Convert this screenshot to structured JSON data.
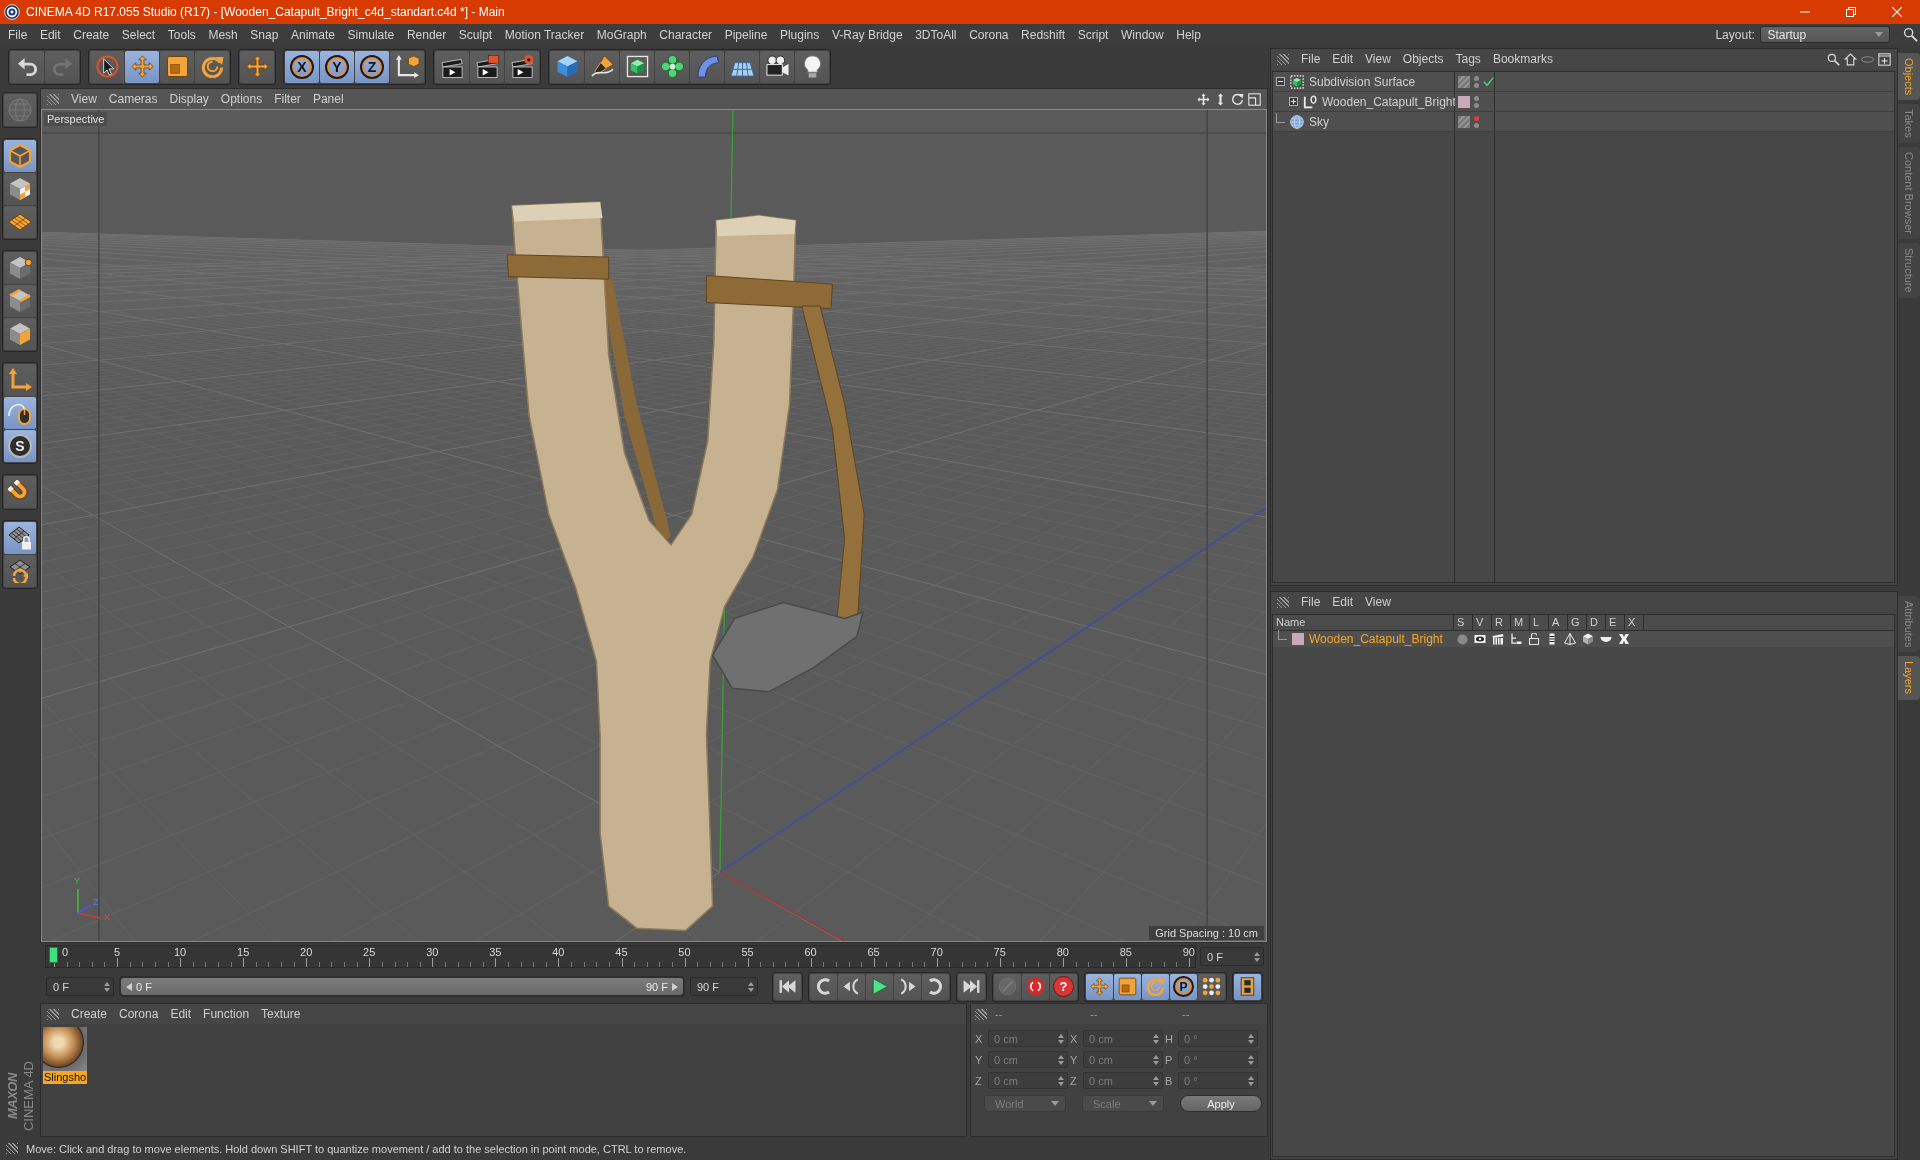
{
  "window": {
    "title": "CINEMA 4D R17.055 Studio (R17) - [Wooden_Catapult_Bright_c4d_standart.c4d *] - Main"
  },
  "menu_bar": {
    "items": [
      "File",
      "Edit",
      "Create",
      "Select",
      "Tools",
      "Mesh",
      "Snap",
      "Animate",
      "Simulate",
      "Render",
      "Sculpt",
      "Motion Tracker",
      "MoGraph",
      "Character",
      "Pipeline",
      "Plugins",
      "V-Ray Bridge",
      "3DToAll",
      "Corona",
      "Redshift",
      "Script",
      "Window",
      "Help"
    ],
    "layout_label": "Layout:",
    "layout_value": "Startup"
  },
  "toolbar": {
    "groups": [
      {
        "buttons": [
          {
            "active": false,
            "disabled": false
          },
          {
            "active": false,
            "disabled": true
          }
        ]
      },
      {
        "buttons": [
          {
            "active": false,
            "disabled": false
          },
          {
            "active": true,
            "disabled": false
          },
          {
            "active": false,
            "disabled": false
          },
          {
            "active": false,
            "disabled": false
          }
        ]
      },
      {
        "buttons": [
          {
            "active": false,
            "disabled": false
          }
        ]
      },
      {
        "buttons": [
          {
            "label": "X",
            "active": true,
            "disabled": false
          },
          {
            "label": "Y",
            "active": true,
            "disabled": false
          },
          {
            "label": "Z",
            "active": true,
            "disabled": false
          },
          {
            "active": false,
            "disabled": false
          }
        ]
      },
      {
        "buttons": [
          {
            "active": false,
            "disabled": false
          },
          {
            "active": false,
            "disabled": false
          },
          {
            "active": false,
            "disabled": false
          }
        ]
      },
      {
        "buttons": [
          {
            "active": false,
            "disabled": false
          },
          {
            "active": false,
            "disabled": false
          },
          {
            "active": false,
            "disabled": false
          },
          {
            "active": false,
            "disabled": false
          },
          {
            "active": false,
            "disabled": false
          },
          {
            "active": false,
            "disabled": false
          },
          {
            "active": false,
            "disabled": false
          },
          {
            "active": false,
            "disabled": false
          }
        ]
      }
    ]
  },
  "left_toolbar": {
    "groups": [
      {
        "buttons": [
          {
            "active": false,
            "disabled": true
          }
        ]
      },
      {
        "buttons": [
          {
            "active": true,
            "disabled": false
          },
          {
            "active": false,
            "disabled": false
          },
          {
            "active": false,
            "disabled": false
          }
        ]
      },
      {
        "buttons": [
          {
            "active": false,
            "disabled": false
          },
          {
            "active": false,
            "disabled": false
          },
          {
            "active": false,
            "disabled": false
          }
        ]
      },
      {
        "buttons": [
          {
            "active": false,
            "disabled": false
          },
          {
            "active": true,
            "disabled": false
          },
          {
            "label": "S",
            "active": true,
            "disabled": false
          }
        ]
      },
      {
        "buttons": [
          {
            "active": false,
            "disabled": false
          }
        ]
      },
      {
        "buttons": [
          {
            "active": true,
            "disabled": false
          },
          {
            "active": false,
            "disabled": false
          }
        ]
      }
    ]
  },
  "brand": {
    "company": "MAXON",
    "product": "CINEMA 4D"
  },
  "viewport": {
    "menu": [
      "View",
      "Cameras",
      "Display",
      "Options",
      "Filter",
      "Panel"
    ],
    "camera": "Perspective",
    "grid_spacing": "Grid Spacing : 10 cm",
    "axis_labels": [
      "Y",
      "Z",
      "X"
    ]
  },
  "timeline": {
    "ticks": [
      "0",
      "5",
      "10",
      "15",
      "20",
      "25",
      "30",
      "35",
      "40",
      "45",
      "50",
      "55",
      "60",
      "65",
      "70",
      "75",
      "80",
      "85",
      "90"
    ],
    "level": 0,
    "frame_field": "0 F"
  },
  "playback": {
    "start_field": "0 F",
    "range": {
      "start_label": "0 F",
      "end_label": "90 F",
      "level": 1
    },
    "end_field": "90 F",
    "groups": [
      {
        "buttons": [
          {
            "active": false,
            "disabled": false
          }
        ]
      },
      {
        "buttons": [
          {
            "active": false,
            "disabled": false
          },
          {
            "active": false,
            "disabled": false
          },
          {
            "active": false,
            "disabled": false
          },
          {
            "active": false,
            "disabled": false
          },
          {
            "active": false,
            "disabled": false
          }
        ]
      },
      {
        "buttons": [
          {
            "active": false,
            "disabled": false
          }
        ]
      },
      {
        "buttons": [
          {
            "active": false,
            "disabled": true
          },
          {
            "active": false,
            "disabled": false
          },
          {
            "label": "?",
            "active": false,
            "disabled": false
          }
        ]
      },
      {
        "buttons": [
          {
            "active": true,
            "disabled": false
          },
          {
            "active": true,
            "disabled": false
          },
          {
            "active": true,
            "disabled": false
          },
          {
            "label": "P",
            "active": true,
            "disabled": false
          },
          {
            "active": false,
            "disabled": false
          }
        ]
      },
      {
        "buttons": [
          {
            "active": true,
            "disabled": false
          }
        ]
      }
    ]
  },
  "material_manager": {
    "menu": [
      "Create",
      "Corona",
      "Edit",
      "Function",
      "Texture"
    ],
    "materials": [
      {
        "name": "Slingsho",
        "selected": true
      }
    ]
  },
  "coordinates": {
    "headers": [
      "--",
      "--",
      "--"
    ],
    "disabled": true,
    "rows": [
      {
        "position_axis": "X",
        "position": "0 cm",
        "size_axis": "X",
        "size": "0 cm",
        "rotation_axis": "H",
        "rotation": "0 °"
      },
      {
        "position_axis": "Y",
        "position": "0 cm",
        "size_axis": "Y",
        "size": "0 cm",
        "rotation_axis": "P",
        "rotation": "0 °"
      },
      {
        "position_axis": "Z",
        "position": "0 cm",
        "size_axis": "Z",
        "size": "0 cm",
        "rotation_axis": "B",
        "rotation": "0 °"
      }
    ],
    "mode": "World",
    "size_mode": "Scale",
    "apply": "Apply"
  },
  "status_bar": {
    "text": "Move: Click and drag to move elements. Hold down SHIFT to quantize movement / add to the selection in point mode, CTRL to remove."
  },
  "object_manager": {
    "menu": [
      "File",
      "Edit",
      "View",
      "Objects",
      "Tags",
      "Bookmarks"
    ],
    "objects": [
      {
        "name": "Subdivision Surface",
        "kind": "generator",
        "expanded": true,
        "enabled": true,
        "selected": false,
        "visible_in_editor": true,
        "visible_in_render": true,
        "children": [
          {
            "name": "Wooden_Catapult_Bright",
            "kind": "null",
            "expanded": false,
            "color": "#c9a9b7",
            "selected": false,
            "visible_in_editor": true,
            "visible_in_render": true
          }
        ]
      },
      {
        "name": "Sky",
        "kind": "sky",
        "selected": false,
        "visible_in_editor": false,
        "visible_in_render": true
      }
    ]
  },
  "layer_manager": {
    "menu": [
      "File",
      "Edit",
      "View"
    ],
    "columns": [
      "Name",
      "S",
      "V",
      "R",
      "M",
      "L",
      "A",
      "G",
      "D",
      "E",
      "X"
    ],
    "layers": [
      {
        "name": "Wooden_Catapult_Bright",
        "color": "#c9a9b7",
        "selected": true,
        "switches": [
          {
            "on": false
          },
          {
            "on": true
          },
          {
            "on": true
          },
          {
            "on": true
          },
          {
            "on": false
          },
          {
            "on": true
          },
          {
            "on": true
          },
          {
            "on": true
          },
          {
            "on": true
          },
          {
            "on": true
          }
        ]
      }
    ]
  },
  "side_tabs": {
    "upper": [
      {
        "label": "Objects",
        "selected": true
      },
      {
        "label": "Takes",
        "selected": false
      },
      {
        "label": "Content Browser",
        "selected": false
      },
      {
        "label": "Structure",
        "selected": false
      }
    ],
    "lower": [
      {
        "label": "Attributes",
        "selected": false
      },
      {
        "label": "Layers",
        "selected": true
      }
    ]
  }
}
